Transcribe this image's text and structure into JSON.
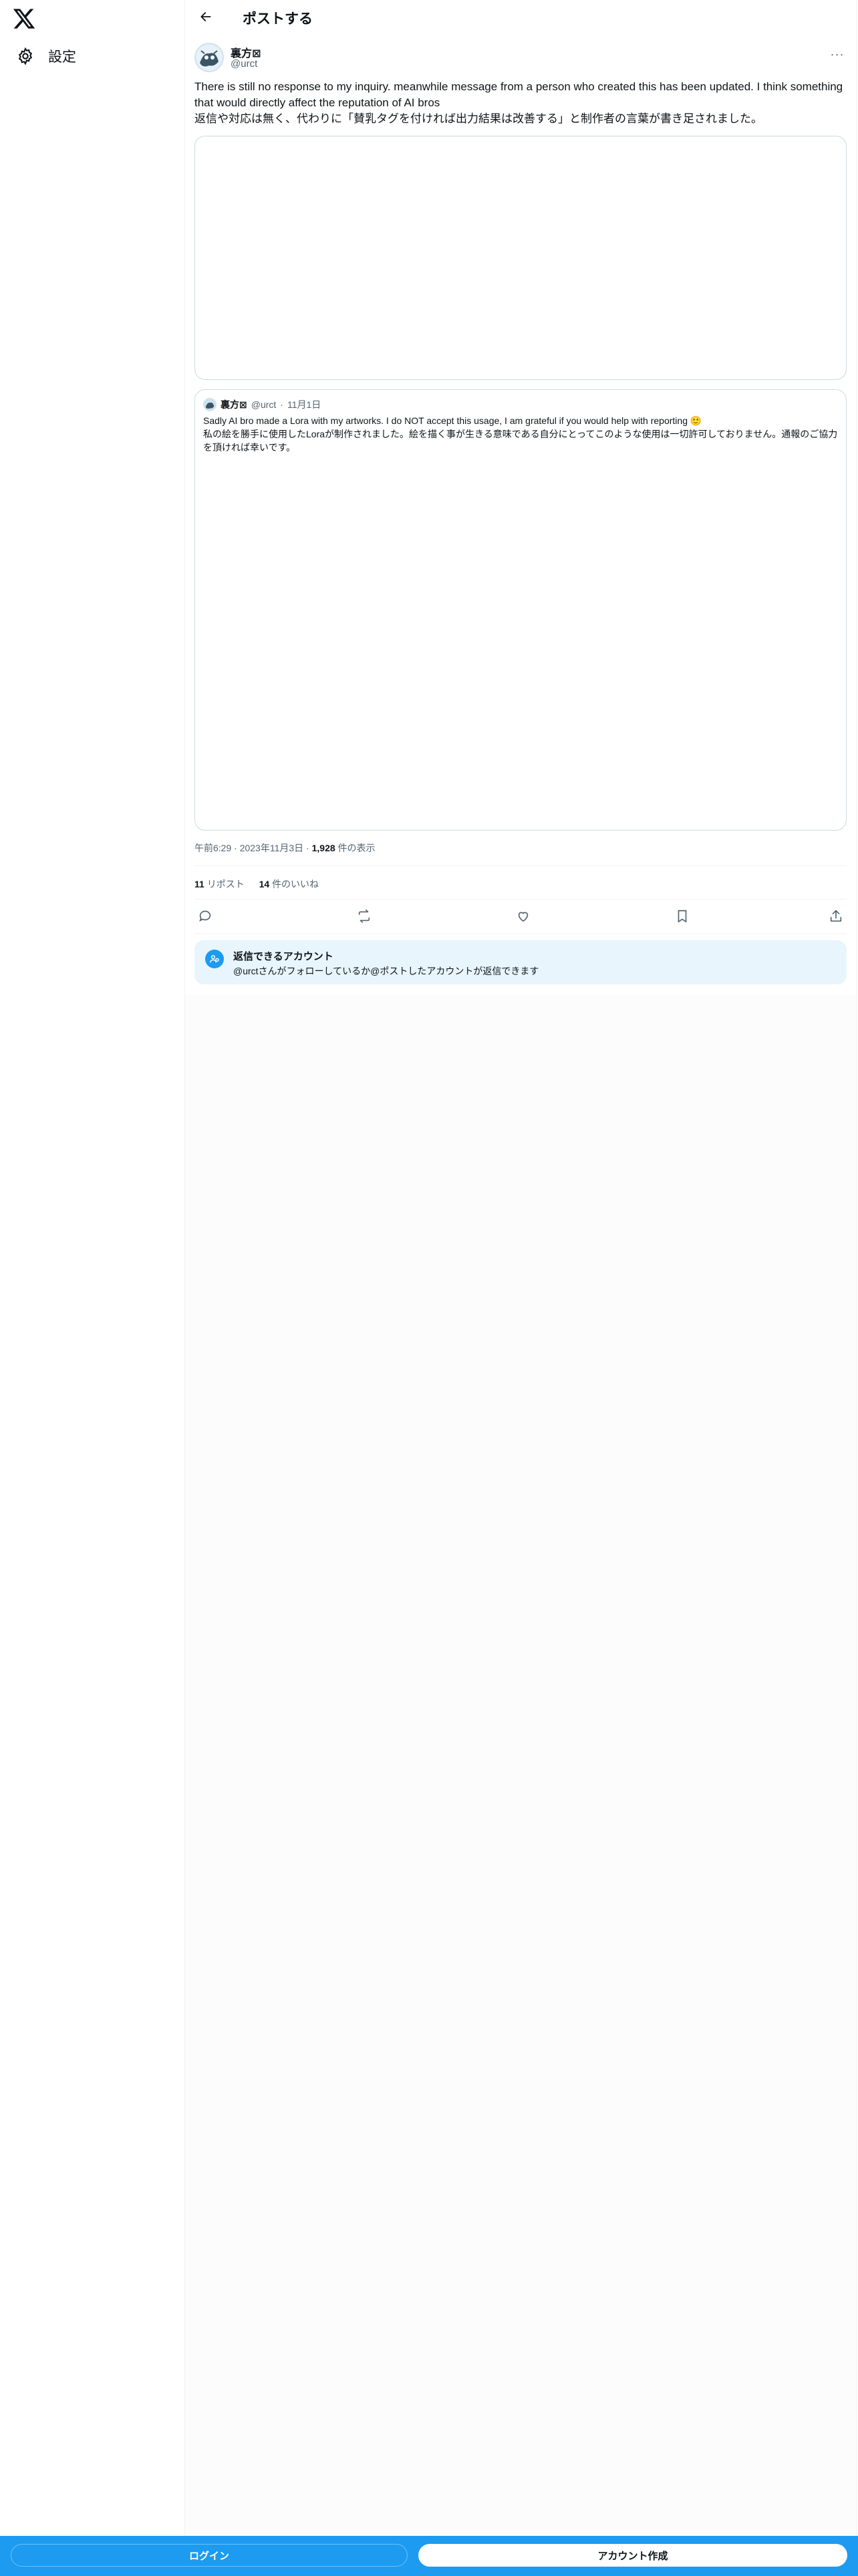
{
  "sidebar": {
    "logo_icon": "x-logo-icon",
    "settings": {
      "icon": "gear-icon",
      "label": "設定"
    }
  },
  "header": {
    "back_icon": "arrow-left-icon",
    "title": "ポストする"
  },
  "post": {
    "author_name": "裏方",
    "author_name_suffix": "⊠",
    "author_handle": "@urct",
    "more_icon": "more-horizontal-icon",
    "more_label": "···",
    "text_en": "There is still no response to my inquiry. meanwhile message from a person who created this has been updated. I think something that would directly affect the reputation of AI bros",
    "text_ja": "返信や対応は無く、代わりに「賛乳タグを付ければ出力結果は改善する」と制作者の言葉が書き足されました。",
    "timestamp": "午前6:29 · 2023年11月3日",
    "views_count": "1,928",
    "views_label": "件の表示",
    "reposts_count": "11",
    "reposts_label": "リポスト",
    "likes_count": "14",
    "likes_label": "件のいいね"
  },
  "quote": {
    "author_name": "裏方⊠",
    "author_handle": "@urct",
    "date": "11月1日",
    "text_en": "Sadly AI bro made a Lora with my artworks. I do NOT accept this usage, I am grateful if you would help with reporting 🙂",
    "text_ja": "私の絵を勝手に使用したLoraが制作されました。絵を描く事が生きる意味である自分にとってこのような使用は一切許可しておりません。通報のご協力を頂ければ幸いです。"
  },
  "actions": {
    "reply_icon": "reply-icon",
    "repost_icon": "repost-icon",
    "like_icon": "heart-icon",
    "bookmark_icon": "bookmark-icon",
    "share_icon": "share-icon"
  },
  "reply_restriction": {
    "icon": "at-user-icon",
    "title": "返信できるアカウント",
    "subtitle": "@urctさんがフォローしているか@ポストしたアカウントが返信できます"
  },
  "bottom_bar": {
    "login_label": "ログイン",
    "signup_label": "アカウント作成"
  },
  "colors": {
    "accent": "#1d9bf0",
    "text": "#0f1419",
    "secondary_text": "#536471",
    "border": "#cfd9de",
    "reply_box_bg": "#e8f5fd"
  }
}
